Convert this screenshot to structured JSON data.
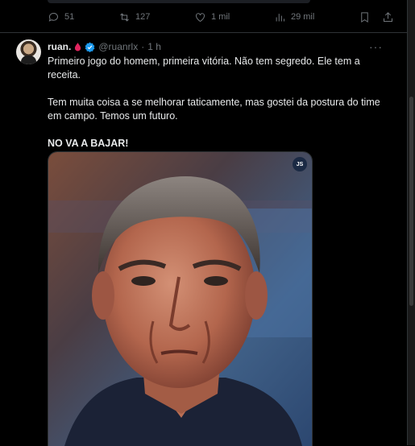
{
  "previous_post": {
    "replies": "51",
    "reposts": "127",
    "likes": "1 mil",
    "views": "29 mil"
  },
  "post": {
    "display_name": "ruan.",
    "handle": "@ruanrlx",
    "separator": "·",
    "time": "1 h",
    "paragraphs": [
      "Primeiro jogo do homem, primeira vitória. Não tem segredo. Ele tem a receita.",
      "Tem muita coisa a se melhorar taticamente, mas gostei da postura do time em campo. Temos um futuro.",
      "NO VA A BAJAR!"
    ],
    "media_badge": "JS",
    "icons": {
      "reply": "reply-icon",
      "repost": "repost-icon",
      "like": "heart-icon",
      "views": "views-icon",
      "bookmark": "bookmark-icon",
      "share": "share-icon",
      "verified": "verified-badge-icon",
      "drop": "blood-drop-icon",
      "more": "more-options-icon"
    },
    "colors": {
      "accent": "#1d9bf0",
      "drop": "#e0245e",
      "muted": "#71767b"
    }
  }
}
